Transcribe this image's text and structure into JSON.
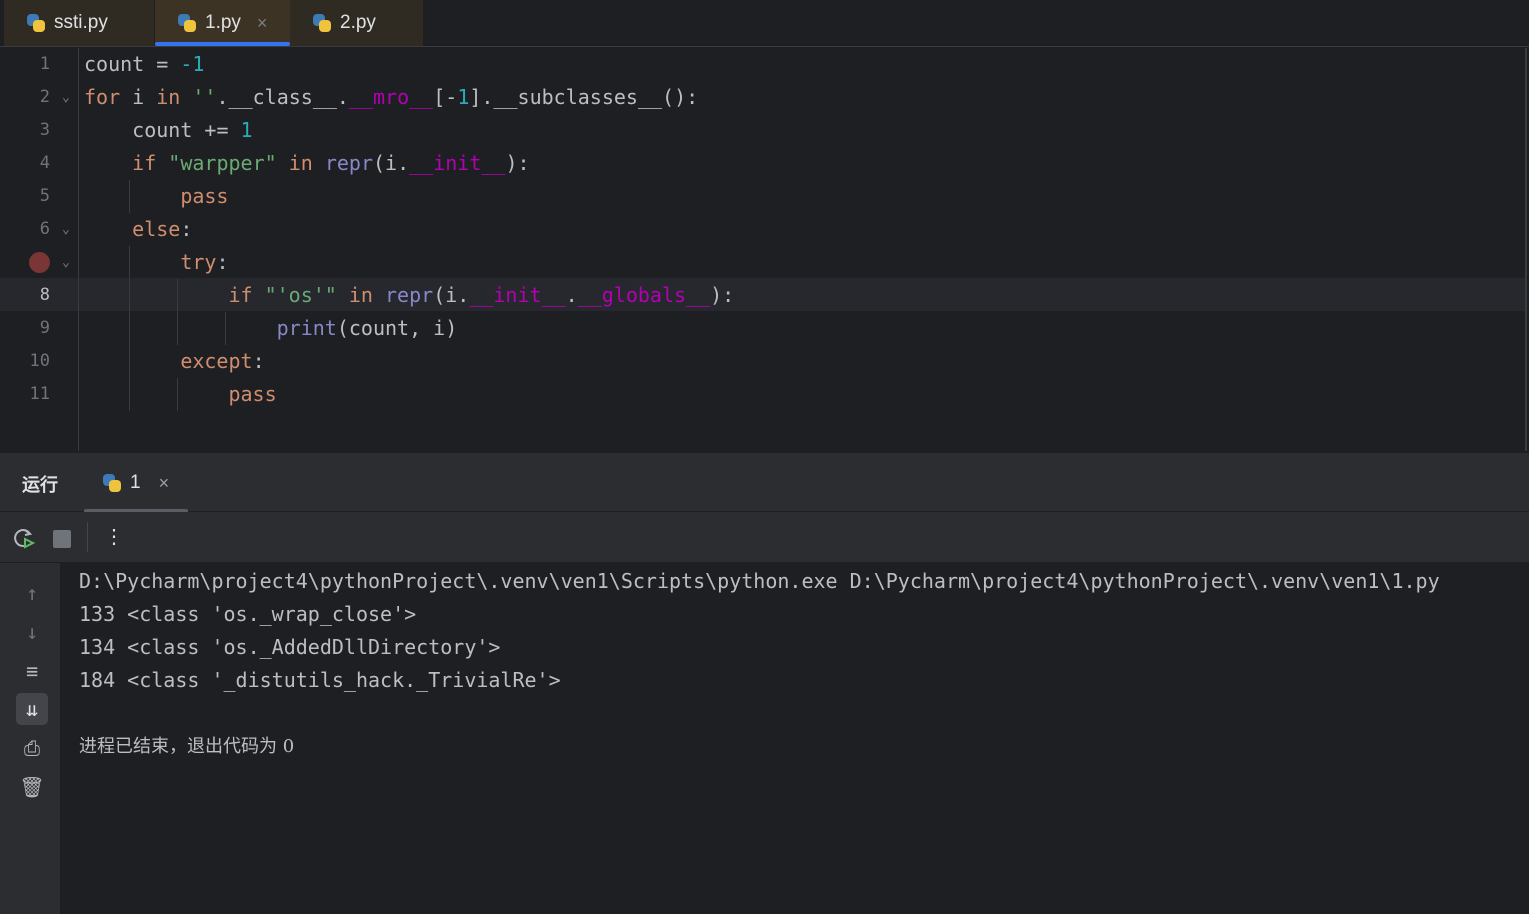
{
  "tabs": [
    {
      "label": "ssti.py",
      "active": false
    },
    {
      "label": "1.py",
      "active": true,
      "close": "×"
    },
    {
      "label": "2.py",
      "active": false
    }
  ],
  "editor": {
    "current_line": 8,
    "breakpoint_line": 7,
    "lines": [
      {
        "n": "1",
        "indent": 0,
        "tokens": [
          [
            "df",
            "count = "
          ],
          [
            "num",
            "-1"
          ]
        ]
      },
      {
        "n": "2",
        "indent": 0,
        "fold": true,
        "tokens": [
          [
            "kw",
            "for "
          ],
          [
            "df",
            "i "
          ],
          [
            "kw",
            "in "
          ],
          [
            "str",
            "''"
          ],
          [
            "df",
            ".__class__."
          ],
          [
            "mag",
            "__mro__"
          ],
          [
            "df",
            "[-"
          ],
          [
            "num",
            "1"
          ],
          [
            "df",
            "].__subclasses__():"
          ]
        ]
      },
      {
        "n": "3",
        "indent": 1,
        "tokens": [
          [
            "df",
            "count += "
          ],
          [
            "num",
            "1"
          ]
        ]
      },
      {
        "n": "4",
        "indent": 1,
        "tokens": [
          [
            "kw",
            "if "
          ],
          [
            "str",
            "\"warpper\" "
          ],
          [
            "kw",
            "in "
          ],
          [
            "bi",
            "repr"
          ],
          [
            "df",
            "(i."
          ],
          [
            "mag",
            "__init__"
          ],
          [
            "df",
            "):"
          ]
        ]
      },
      {
        "n": "5",
        "indent": 2,
        "tokens": [
          [
            "kw",
            "pass"
          ]
        ]
      },
      {
        "n": "6",
        "indent": 1,
        "fold": true,
        "tokens": [
          [
            "kw",
            "else"
          ],
          [
            "df",
            ":"
          ]
        ]
      },
      {
        "n": "",
        "indent": 2,
        "fold": true,
        "tokens": [
          [
            "kw",
            "try"
          ],
          [
            "df",
            ":"
          ]
        ]
      },
      {
        "n": "8",
        "indent": 3,
        "tokens": [
          [
            "kw",
            "if "
          ],
          [
            "str",
            "\"'os'\" "
          ],
          [
            "kw",
            "in "
          ],
          [
            "bi",
            "repr"
          ],
          [
            "df",
            "(i."
          ],
          [
            "mag",
            "__init__"
          ],
          [
            "df",
            "."
          ],
          [
            "mag",
            "__globals__"
          ],
          [
            "df",
            "):"
          ]
        ]
      },
      {
        "n": "9",
        "indent": 4,
        "tokens": [
          [
            "bi",
            "print"
          ],
          [
            "df",
            "(count, i)"
          ]
        ]
      },
      {
        "n": "10",
        "indent": 2,
        "tokens": [
          [
            "kw",
            "except"
          ],
          [
            "df",
            ":"
          ]
        ]
      },
      {
        "n": "11",
        "indent": 3,
        "tokens": [
          [
            "kw",
            "pass"
          ]
        ]
      }
    ]
  },
  "run_panel": {
    "title": "运行",
    "tab_label": "1",
    "tab_close": "×",
    "toolbar": {
      "rerun": "rerun-icon",
      "stop": "stop-icon",
      "more": "⋮"
    },
    "side_icons": [
      "arrow-up-icon",
      "arrow-down-icon",
      "soft-wrap-icon",
      "scroll-to-end-icon",
      "print-icon",
      "trash-icon"
    ],
    "output": [
      "D:\\Pycharm\\project4\\pythonProject\\.venv\\ven1\\Scripts\\python.exe D:\\Pycharm\\project4\\pythonProject\\.venv\\ven1\\1.py",
      "133 <class 'os._wrap_close'>",
      "134 <class 'os._AddedDllDirectory'>",
      "184 <class '_distutils_hack._TrivialRe'>",
      "",
      "进程已结束，退出代码为 0"
    ]
  },
  "colors": {
    "keyword": "#cf8e6d",
    "number": "#2aacb8",
    "string": "#6aab73",
    "dunder": "#b200b2",
    "builtin": "#8888c6",
    "accent": "#3574f0"
  }
}
